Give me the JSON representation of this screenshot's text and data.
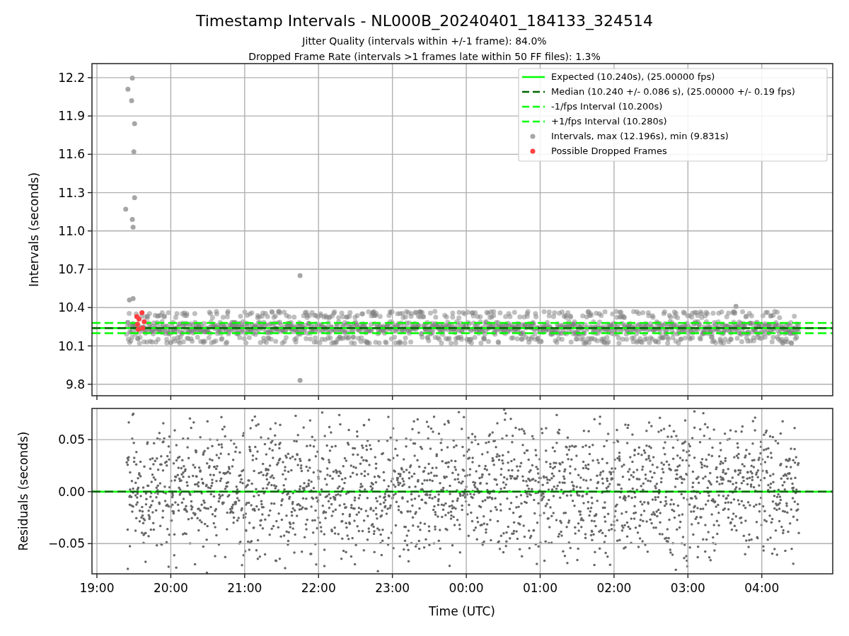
{
  "figure": {
    "title": "Timestamp Intervals - NL000B_20240401_184133_324514",
    "subtitles": [
      "Jitter Quality (intervals within +/-1 frame): 84.0%",
      "Dropped Frame Rate (intervals >1 frames late within 50 FF files): 1.3%"
    ]
  },
  "intervals_plot": {
    "chart_data": {
      "type": "scatter",
      "ylabel": "Intervals (seconds)",
      "grid": true,
      "legend": "upper right",
      "xlim": [
        "2024-04-01T18:56:00",
        "2024-04-02T04:57:36"
      ],
      "ylim": [
        9.71,
        12.31
      ],
      "yticks": [
        {
          "value": 9.8,
          "label": "9.8"
        },
        {
          "value": 10.1,
          "label": "10.1"
        },
        {
          "value": 10.4,
          "label": "10.4"
        },
        {
          "value": 10.7,
          "label": "10.7"
        },
        {
          "value": 11.0,
          "label": "11.0"
        },
        {
          "value": 11.3,
          "label": "11.3"
        },
        {
          "value": 11.6,
          "label": "11.6"
        },
        {
          "value": 11.9,
          "label": "11.9"
        },
        {
          "value": 12.2,
          "label": "12.2"
        }
      ],
      "ref_lines": [
        {
          "axis": "y",
          "value": 10.24,
          "label": "Expected (10.240s), (25.00000 fps)",
          "color": "#00ff00"
        },
        {
          "axis": "y",
          "value": 10.24,
          "label": "Median (10.240 +/- 0.086 s), (25.00000 +/- 0.19 fps)",
          "color": "#006400"
        },
        {
          "axis": "y",
          "value": 10.2,
          "label": "-1/fps Interval (10.200s)",
          "color": "#00ff00"
        },
        {
          "axis": "y",
          "value": 10.28,
          "label": "+1/fps Interval (10.280s)",
          "color": "#00ff00"
        }
      ],
      "series": [
        {
          "name": "Intervals, max (12.196s), min (9.831s)",
          "color": "#a6a6a6",
          "x": [
            "2024-04-01T19:28:48",
            "2024-04-01T19:25:12",
            "2024-04-01T19:28:12",
            "2024-04-01T19:30:36",
            "2024-04-01T19:30:00",
            "2024-04-01T19:30:36",
            "2024-04-01T19:23:24",
            "2024-04-01T19:28:48",
            "2024-04-01T19:29:24",
            "2024-04-01T19:26:24",
            "2024-04-01T19:29:24",
            "2024-04-01T21:45:00",
            "2024-04-01T21:45:00",
            "2024-04-02T03:39:00"
          ],
          "values": [
            12.196,
            12.11,
            12.02,
            11.84,
            11.62,
            11.26,
            11.17,
            11.09,
            11.03,
            10.46,
            10.47,
            10.65,
            9.831,
            10.41
          ]
        },
        {
          "name": "Possible Dropped Frames",
          "color": "#ff4040",
          "x": [
            "2024-04-01T19:36:36",
            "2024-04-01T19:32:24",
            "2024-04-01T19:34:12",
            "2024-04-01T19:38:24",
            "2024-04-01T19:33:00",
            "2024-04-01T19:37:12",
            "2024-04-01T19:33:36"
          ],
          "values": [
            10.36,
            10.33,
            10.31,
            10.29,
            10.27,
            10.24,
            10.23
          ]
        }
      ]
    }
  },
  "residuals_plot": {
    "chart_data": {
      "type": "scatter",
      "xlabel": "Time (UTC)",
      "ylabel": "Residuals (seconds)",
      "grid": true,
      "xlim": [
        "2024-04-01T18:56:00",
        "2024-04-02T04:57:36"
      ],
      "ylim": [
        -0.079,
        0.08
      ],
      "xticks": [
        {
          "value": "2024-04-01T19:00:00",
          "label": "19:00"
        },
        {
          "value": "2024-04-01T20:00:00",
          "label": "20:00"
        },
        {
          "value": "2024-04-01T21:00:00",
          "label": "21:00"
        },
        {
          "value": "2024-04-01T22:00:00",
          "label": "22:00"
        },
        {
          "value": "2024-04-01T23:00:00",
          "label": "23:00"
        },
        {
          "value": "2024-04-02T00:00:00",
          "label": "00:00"
        },
        {
          "value": "2024-04-02T01:00:00",
          "label": "01:00"
        },
        {
          "value": "2024-04-02T02:00:00",
          "label": "02:00"
        },
        {
          "value": "2024-04-02T03:00:00",
          "label": "03:00"
        },
        {
          "value": "2024-04-02T04:00:00",
          "label": "04:00"
        }
      ],
      "yticks": [
        {
          "value": -0.05,
          "label": "−0.05"
        },
        {
          "value": 0,
          "label": "0.00"
        },
        {
          "value": 0.05,
          "label": "0.05"
        }
      ],
      "ref_lines": [
        {
          "axis": "y",
          "value": 0,
          "color": "#00ff00"
        },
        {
          "axis": "y",
          "value": 0,
          "color": "#006400"
        }
      ]
    }
  }
}
